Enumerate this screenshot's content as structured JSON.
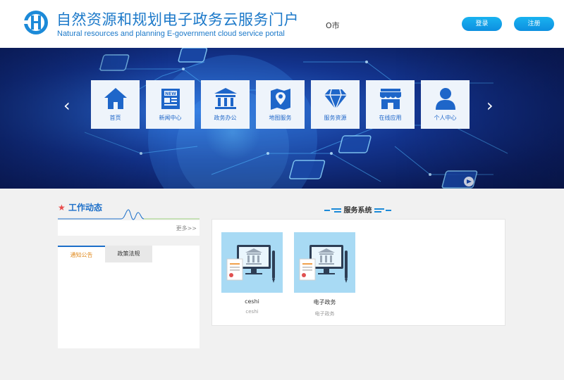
{
  "header": {
    "title": "自然资源和规划电子政务云服务门户",
    "subtitle": "Natural resources and planning E-government cloud service portal",
    "city": "O市",
    "login_label": "登录",
    "register_label": "注册"
  },
  "banner": {
    "prev_symbol": "‹",
    "next_symbol": "›",
    "tiles": [
      {
        "label": "首页",
        "icon": "home-icon"
      },
      {
        "label": "新闻中心",
        "icon": "news-icon"
      },
      {
        "label": "政务办公",
        "icon": "government-building-icon"
      },
      {
        "label": "地图服务",
        "icon": "map-pin-icon"
      },
      {
        "label": "服务资源",
        "icon": "diamond-icon"
      },
      {
        "label": "在线应用",
        "icon": "store-icon"
      },
      {
        "label": "个人中心",
        "icon": "user-icon"
      }
    ]
  },
  "work_news": {
    "title": "工作动态",
    "more_label": "更多>>"
  },
  "notices": {
    "tabs": [
      "通知公告",
      "政策法规"
    ]
  },
  "services": {
    "title": "服务系统",
    "items": [
      {
        "name": "ceshi",
        "desc": "ceshi"
      },
      {
        "name": "电子政务",
        "desc": "电子政务"
      }
    ]
  },
  "colors": {
    "brand_blue": "#1c79c9",
    "button_blue": "#0d8fe0",
    "tab_active_text": "#e08a1e"
  }
}
